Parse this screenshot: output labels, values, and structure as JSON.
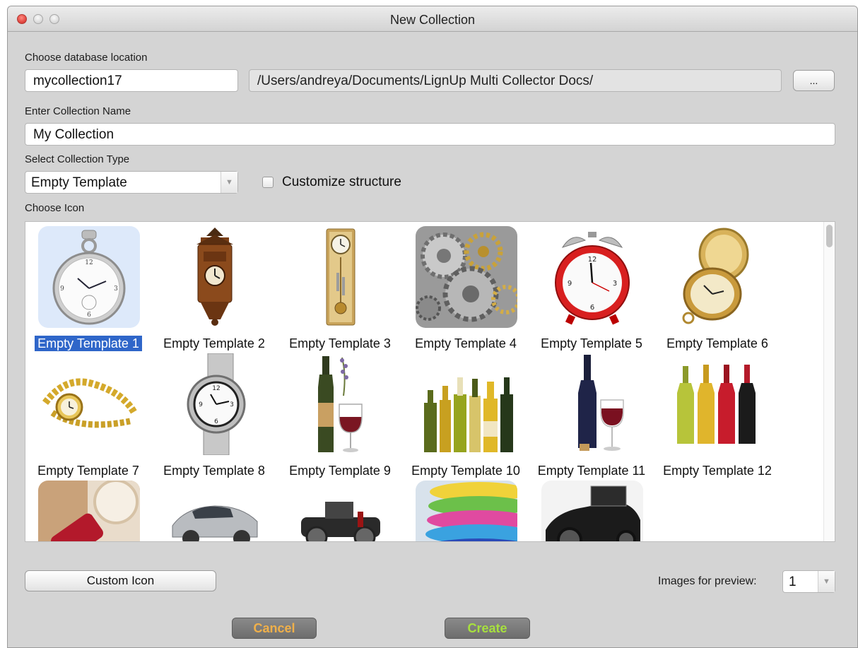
{
  "window": {
    "title": "New Collection"
  },
  "database": {
    "label": "Choose database location",
    "name_value": "mycollection17",
    "path_value": "/Users/andreya/Documents/LignUp Multi Collector Docs/",
    "browse_label": "..."
  },
  "collection_name": {
    "label": "Enter Collection Name",
    "value": "My Collection"
  },
  "collection_type": {
    "label": "Select Collection Type",
    "selected": "Empty Template",
    "customize_label": "Customize structure",
    "customize_checked": false
  },
  "icons": {
    "label": "Choose Icon",
    "selected_index": 0,
    "items": [
      {
        "caption": "Empty Template 1",
        "icon": "pocket-watch-icon"
      },
      {
        "caption": "Empty Template 2",
        "icon": "cuckoo-clock-icon"
      },
      {
        "caption": "Empty Template 3",
        "icon": "pendulum-clock-icon"
      },
      {
        "caption": "Empty Template 4",
        "icon": "gears-icon"
      },
      {
        "caption": "Empty Template 5",
        "icon": "alarm-clock-icon"
      },
      {
        "caption": "Empty Template 6",
        "icon": "open-pocket-watch-icon"
      },
      {
        "caption": "Empty Template 7",
        "icon": "gold-wristwatch-icon"
      },
      {
        "caption": "Empty Template 8",
        "icon": "steel-wristwatch-icon"
      },
      {
        "caption": "Empty Template 9",
        "icon": "wine-and-glasses-icon"
      },
      {
        "caption": "Empty Template 10",
        "icon": "wine-bottles-icon"
      },
      {
        "caption": "Empty Template 11",
        "icon": "wine-bottle-glass-icon"
      },
      {
        "caption": "Empty Template 12",
        "icon": "four-wine-bottles-icon"
      },
      {
        "caption": "",
        "icon": "wine-cork-icon"
      },
      {
        "caption": "",
        "icon": "silver-sports-car-icon"
      },
      {
        "caption": "",
        "icon": "vintage-car-icon"
      },
      {
        "caption": "",
        "icon": "colorful-cars-icon"
      },
      {
        "caption": "",
        "icon": "black-vintage-car-icon"
      }
    ]
  },
  "custom_icon_label": "Custom Icon",
  "preview": {
    "label": "Images for preview:",
    "value": "1"
  },
  "buttons": {
    "cancel": "Cancel",
    "create": "Create"
  },
  "colors": {
    "cancel_text": "#f0b04a",
    "create_text": "#a7e03e",
    "selection": "#2f66c9"
  }
}
